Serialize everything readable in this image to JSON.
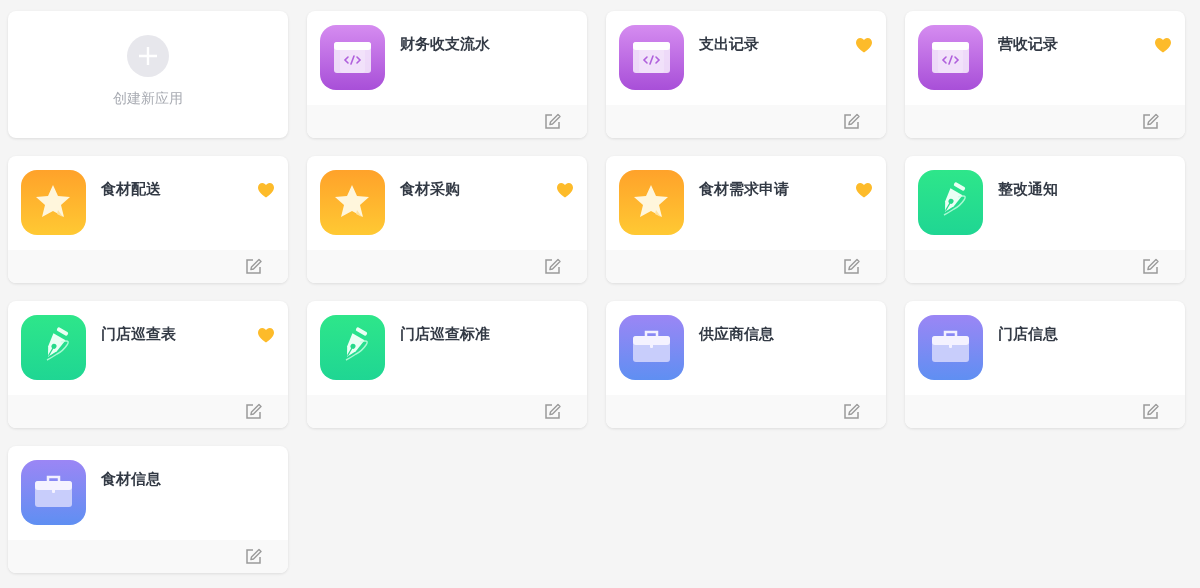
{
  "create_card": {
    "label": "创建新应用"
  },
  "apps": [
    {
      "name": "财务收支流水",
      "kind": "code",
      "favorite": false
    },
    {
      "name": "支出记录",
      "kind": "code",
      "favorite": true
    },
    {
      "name": "营收记录",
      "kind": "code",
      "favorite": true
    },
    {
      "name": "食材配送",
      "kind": "star",
      "favorite": true
    },
    {
      "name": "食材采购",
      "kind": "star",
      "favorite": true
    },
    {
      "name": "食材需求申请",
      "kind": "star",
      "favorite": true
    },
    {
      "name": "整改通知",
      "kind": "pen",
      "favorite": false
    },
    {
      "name": "门店巡查表",
      "kind": "pen",
      "favorite": true
    },
    {
      "name": "门店巡查标准",
      "kind": "pen",
      "favorite": false
    },
    {
      "name": "供应商信息",
      "kind": "case",
      "favorite": false
    },
    {
      "name": "门店信息",
      "kind": "case",
      "favorite": false
    },
    {
      "name": "食材信息",
      "kind": "case",
      "favorite": false
    }
  ]
}
